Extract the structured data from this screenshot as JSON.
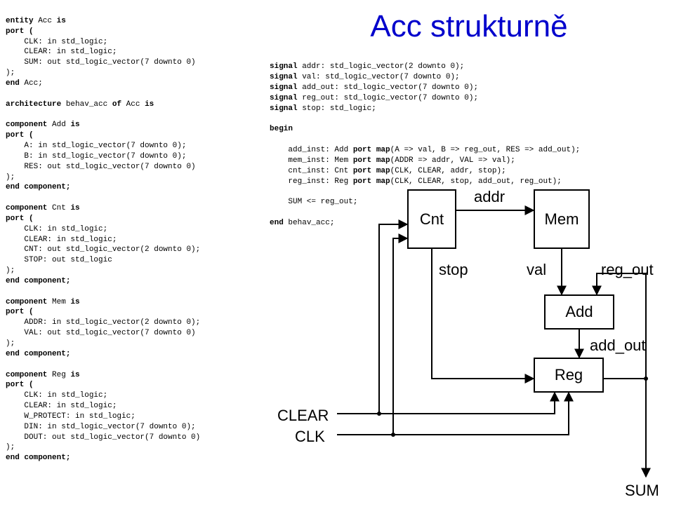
{
  "title": "Acc strukturně",
  "left_code": {
    "l01a": "entity",
    "l01b": " Acc ",
    "l01c": "is",
    "l02a": "port (",
    "l03": "    CLK: in std_logic;",
    "l04": "    CLEAR: in std_logic;",
    "l05": "    SUM: out std_logic_vector(7 downto 0)",
    "l06": ");",
    "l07a": "end",
    "l07b": " Acc;",
    "l08": " ",
    "l09a": "architecture",
    "l09b": " behav_acc ",
    "l09c": "of",
    "l09d": " Acc ",
    "l09e": "is",
    "l10": " ",
    "l11a": "component",
    "l11b": " Add ",
    "l11c": "is",
    "l12a": "port (",
    "l13": "    A: in std_logic_vector(7 downto 0);",
    "l14": "    B: in std_logic_vector(7 downto 0);",
    "l15": "    RES: out std_logic_vector(7 downto 0)",
    "l16": ");",
    "l17a": "end component;",
    "l18": " ",
    "l19a": "component",
    "l19b": " Cnt ",
    "l19c": "is",
    "l20a": "port (",
    "l21": "    CLK: in std_logic;",
    "l22": "    CLEAR: in std_logic;",
    "l23": "    CNT: out std_logic_vector(2 downto 0);",
    "l24": "    STOP: out std_logic",
    "l25": ");",
    "l26a": "end component;",
    "l27": " ",
    "l28a": "component",
    "l28b": " Mem ",
    "l28c": "is",
    "l29a": "port (",
    "l30": "    ADDR: in std_logic_vector(2 downto 0);",
    "l31": "    VAL: out std_logic_vector(7 downto 0)",
    "l32": ");",
    "l33a": "end component;",
    "l34": " ",
    "l35a": "component",
    "l35b": " Reg ",
    "l35c": "is",
    "l36a": "port (",
    "l37": "    CLK: in std_logic;",
    "l38": "    CLEAR: in std_logic;",
    "l39": "    W_PROTECT: in std_logic;",
    "l40": "    DIN: in std_logic_vector(7 downto 0);",
    "l41": "    DOUT: out std_logic_vector(7 downto 0)",
    "l42": ");",
    "l43a": "end component;"
  },
  "right_code": {
    "s1a": "signal",
    "s1b": " addr: std_logic_vector(2 downto 0);",
    "s2a": "signal",
    "s2b": " val: std_logic_vector(7 downto 0);",
    "s3a": "signal",
    "s3b": " add_out: std_logic_vector(7 downto 0);",
    "s4a": "signal",
    "s4b": " reg_out: std_logic_vector(7 downto 0);",
    "s5a": "signal",
    "s5b": " stop: std_logic;",
    "b1": "begin",
    "i1a": "    add_inst: Add ",
    "i1b": "port map",
    "i1c": "(A => val, B => reg_out, RES => add_out);",
    "i2a": "    mem_inst: Mem ",
    "i2b": "port map",
    "i2c": "(ADDR => addr, VAL => val);",
    "i3a": "    cnt_inst: Cnt ",
    "i3b": "port map",
    "i3c": "(CLK, CLEAR, addr, stop);",
    "i4a": "    reg_inst: Reg ",
    "i4b": "port map",
    "i4c": "(CLK, CLEAR, stop, add_out, reg_out);",
    "s6": "    SUM <= reg_out;",
    "e1a": "end",
    "e1b": " behav_acc;"
  },
  "diagram": {
    "clear": "CLEAR",
    "clk": "CLK",
    "cnt": "Cnt",
    "mem": "Mem",
    "add": "Add",
    "reg": "Reg",
    "addr": "addr",
    "stop": "stop",
    "val": "val",
    "regout": "reg_out",
    "addout": "add_out",
    "sum": "SUM"
  }
}
